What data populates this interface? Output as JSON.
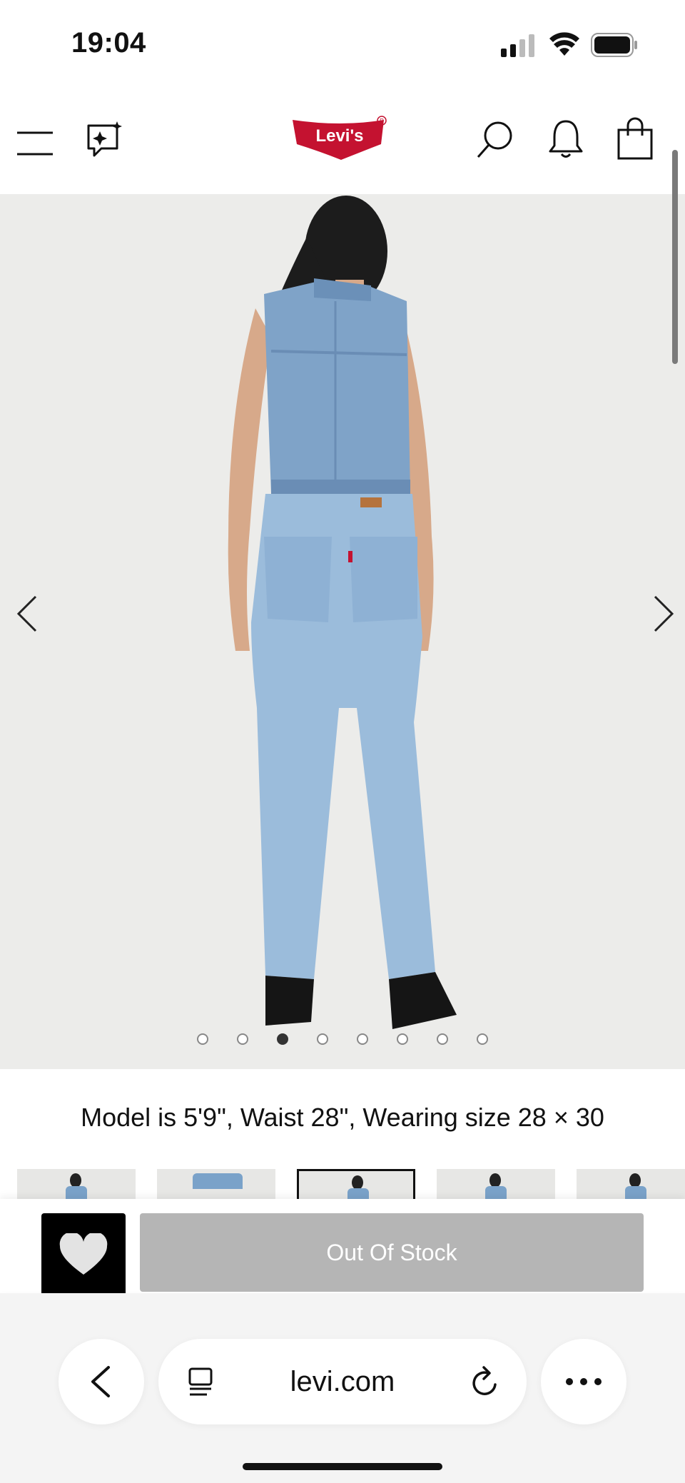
{
  "status_bar": {
    "time": "19:04"
  },
  "header": {
    "brand": "Levi's",
    "icons": [
      "menu-icon",
      "ai-sparkle-icon",
      "search-icon",
      "bell-icon",
      "shopping-bag-icon"
    ]
  },
  "gallery": {
    "image_count": 8,
    "active_index": 2,
    "model_note": "Model is 5'9\", Waist 28\", Wearing size 28 × 30"
  },
  "actions": {
    "oos_label": "Out Of Stock"
  },
  "browser": {
    "url": "levi.com"
  },
  "colors": {
    "brand_red": "#c41230",
    "oos_gray": "#b5b5b5",
    "image_bg": "#ececea"
  }
}
